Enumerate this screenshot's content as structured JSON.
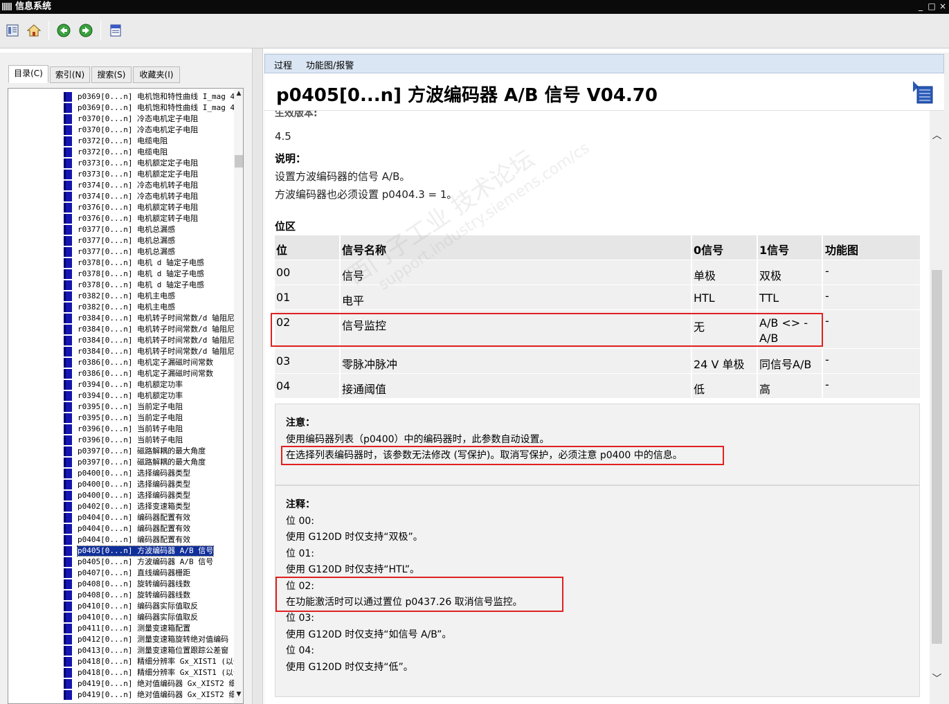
{
  "window": {
    "title": "信息系统",
    "controls": [
      "_",
      "□",
      "×"
    ]
  },
  "toolbar": {
    "buttons": [
      "contents-icon",
      "home-icon",
      "back-icon",
      "forward-icon",
      "print-icon"
    ]
  },
  "left": {
    "tabs": [
      "目录(C)",
      "索引(N)",
      "搜索(S)",
      "收藏夹(I)"
    ],
    "tree_items": [
      "p0369[0...n] 电机饱和特性曲线 I_mag 4",
      "p0369[0...n] 电机饱和特性曲线 I_mag 4",
      "r0370[0...n] 冷态电机定子电阻",
      "r0370[0...n] 冷态电机定子电阻",
      "r0372[0...n] 电缆电阻",
      "r0372[0...n] 电缆电阻",
      "r0373[0...n] 电机额定定子电阻",
      "r0373[0...n] 电机额定定子电阻",
      "r0374[0...n] 冷态电机转子电阻",
      "r0374[0...n] 冷态电机转子电阻",
      "r0376[0...n] 电机额定转子电阻",
      "r0376[0...n] 电机额定转子电阻",
      "r0377[0...n] 电机总漏感",
      "r0377[0...n] 电机总漏感",
      "r0377[0...n] 电机总漏感",
      "r0378[0...n] 电机 d 轴定子电感",
      "r0378[0...n] 电机 d 轴定子电感",
      "r0378[0...n] 电机 d 轴定子电感",
      "r0382[0...n] 电机主电感",
      "r0382[0...n] 电机主电感",
      "r0384[0...n] 电机转子时间常数/d 轴阻尼",
      "r0384[0...n] 电机转子时间常数/d 轴阻尼",
      "r0384[0...n] 电机转子时间常数/d 轴阻尼",
      "r0384[0...n] 电机转子时间常数/d 轴阻尼",
      "r0386[0...n] 电机定子漏磁时间常数",
      "r0386[0...n] 电机定子漏磁时间常数",
      "r0394[0...n] 电机额定功率",
      "r0394[0...n] 电机额定功率",
      "r0395[0...n] 当前定子电阻",
      "r0395[0...n] 当前定子电阻",
      "r0396[0...n] 当前转子电阻",
      "r0396[0...n] 当前转子电阻",
      "p0397[0...n] 磁路解耦的最大角度",
      "p0397[0...n] 磁路解耦的最大角度",
      "p0400[0...n] 选择编码器类型",
      "p0400[0...n] 选择编码器类型",
      "p0400[0...n] 选择编码器类型",
      "p0402[0...n] 选择变速箱类型",
      "p0404[0...n] 编码器配置有效",
      "p0404[0...n] 编码器配置有效",
      "p0404[0...n] 编码器配置有效",
      "p0405[0...n] 方波编码器 A/B 信号",
      "p0405[0...n] 方波编码器 A/B 信号",
      "p0407[0...n] 直线编码器栅距",
      "p0408[0...n] 旋转编码器线数",
      "p0408[0...n] 旋转编码器线数",
      "p0410[0...n] 编码器实际值取反",
      "p0410[0...n] 编码器实际值取反",
      "p0411[0...n] 测量变速箱配置",
      "p0412[0...n] 测量变速箱旋转绝对值编码",
      "p0413[0...n] 测量变速箱位置跟踪公差窗",
      "p0418[0...n] 精细分辨率 Gx_XIST1 (以位",
      "p0418[0...n] 精细分辨率 Gx_XIST1 (以位",
      "p0419[0...n] 绝对值编码器 Gx_XIST2 细",
      "p0419[0...n] 绝对值编码器 Gx_XIST2 细"
    ],
    "selected_index": 41
  },
  "right": {
    "breadcrumb": [
      "过程",
      "功能图/报警"
    ],
    "title": "p0405[0...n] 方波编码器 A/B 信号 V04.70",
    "partial_label": "生效版本:",
    "version_value": "4.5",
    "desc_label": "说明：",
    "desc_lines": [
      "设置方波编码器的信号 A/B。",
      "方波编码器也必须设置 p0404.3 = 1。"
    ],
    "bitfield_label": "位区",
    "table": {
      "headers": [
        "位",
        "信号名称",
        "0信号",
        "1信号",
        "功能图"
      ],
      "rows": [
        [
          "00",
          "信号",
          "单极",
          "双极",
          "-"
        ],
        [
          "01",
          "电平",
          "HTL",
          "TTL",
          "-"
        ],
        [
          "02",
          "信号监控",
          "无",
          "A/B <> -\nA/B",
          "-"
        ],
        [
          "03",
          "零脉冲脉冲",
          "24 V 单极",
          "同信号A/B",
          "-"
        ],
        [
          "04",
          "接通阈值",
          "低",
          "高",
          "-"
        ]
      ]
    },
    "note": {
      "label": "注意：",
      "lines": [
        "使用编码器列表（p0400）中的编码器时，此参数自动设置。",
        "在选择列表编码器时，该参数无法修改 (写保护)。取消写保护，必须注意 p0400 中的信息。"
      ]
    },
    "remarks": {
      "label": "注释：",
      "lines": [
        "位 00:",
        "使用 G120D 时仅支持“双极”。",
        "位 01:",
        "使用 G120D 时仅支持“HTL”。",
        "位 02:",
        "在功能激活时可以通过置位 p0437.26 取消信号监控。",
        "位 03:",
        "使用 G120D 时仅支持“如信号 A/B”。",
        "位 04:",
        "使用 G120D 时仅支持“低”。"
      ]
    },
    "watermark": [
      "西门子工业 技术论坛",
      "support.industry.siemens.com/cs"
    ]
  },
  "colors": {
    "selection": "#102f9a",
    "highlight_box": "#e02020",
    "breadcrumb_bg": "#dbe6f4",
    "tree_icon": "#1515b0"
  }
}
